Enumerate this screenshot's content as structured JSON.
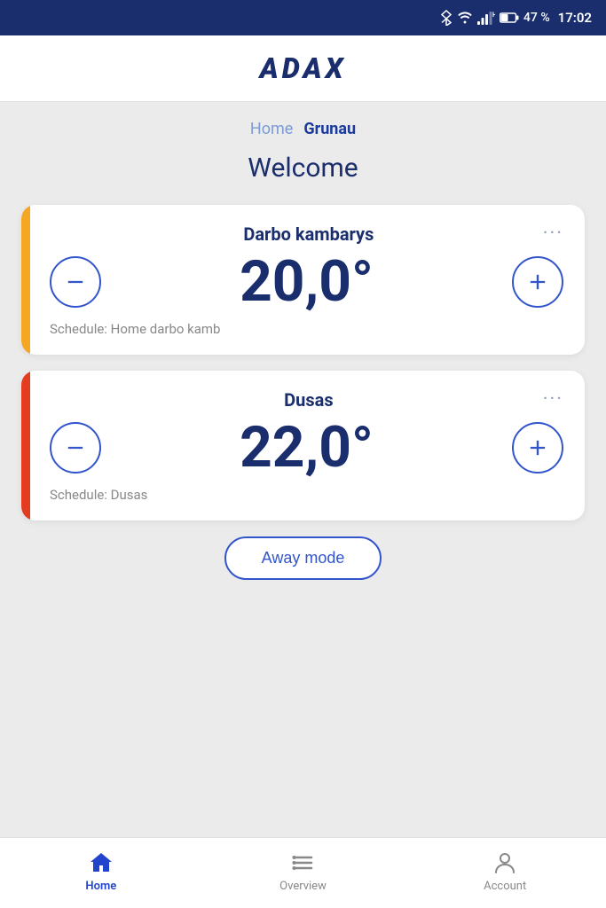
{
  "statusBar": {
    "battery": "47 %",
    "time": "17:02"
  },
  "header": {
    "logo": "ADAX"
  },
  "breadcrumb": {
    "home": "Home",
    "location": "Grunau"
  },
  "welcome": {
    "title": "Welcome"
  },
  "rooms": [
    {
      "name": "Darbo kambarys",
      "temperature": "20,0°",
      "schedule": "Schedule: Home darbo kamb",
      "indicatorColor": "#f5a623"
    },
    {
      "name": "Dusas",
      "temperature": "22,0°",
      "schedule": "Schedule: Dusas",
      "indicatorColor": "#e53b1e"
    }
  ],
  "awayMode": {
    "label": "Away mode"
  },
  "bottomNav": {
    "items": [
      {
        "id": "home",
        "label": "Home",
        "active": true
      },
      {
        "id": "overview",
        "label": "Overview",
        "active": false
      },
      {
        "id": "account",
        "label": "Account",
        "active": false
      }
    ]
  }
}
